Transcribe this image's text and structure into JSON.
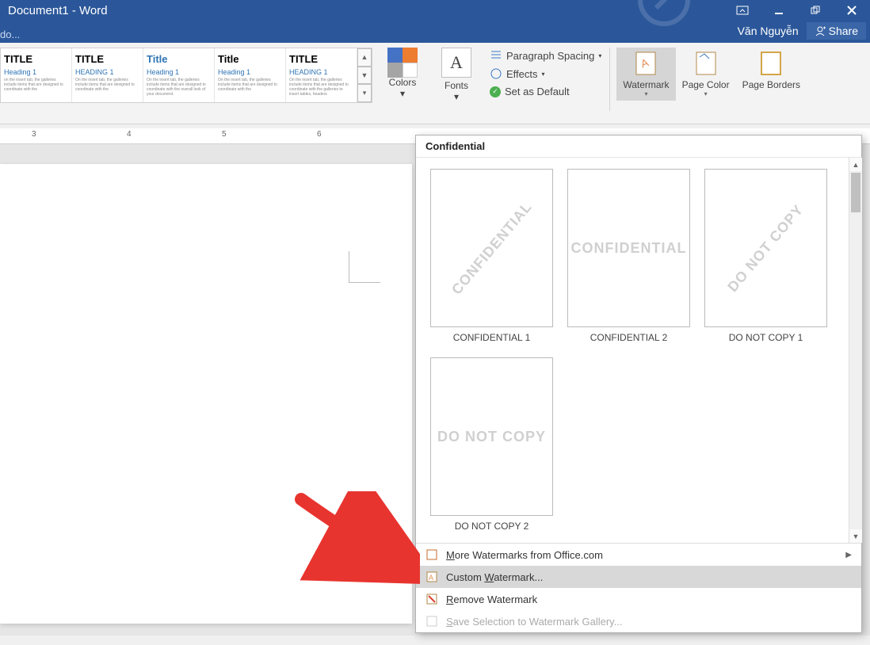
{
  "title": "Document1 - Word",
  "undo_hint": "do...",
  "user": "Văn Nguyễn",
  "share_label": "Share",
  "ribbon": {
    "colors": "Colors",
    "fonts": "Fonts",
    "para_spacing": "Paragraph Spacing",
    "effects": "Effects",
    "set_default": "Set as Default",
    "watermark": "Watermark",
    "page_color": "Page Color",
    "page_borders": "Page Borders"
  },
  "styles": [
    {
      "title": "TITLE",
      "heading": "Heading 1"
    },
    {
      "title": "TITLE",
      "heading": "HEADING 1"
    },
    {
      "title": "Title",
      "heading": "Heading 1"
    },
    {
      "title": "Title",
      "heading": "Heading 1"
    },
    {
      "title": "TITLE",
      "heading": "HEADING 1"
    }
  ],
  "ruler_nums": [
    "3",
    "4",
    "5",
    "6"
  ],
  "watermark_panel": {
    "category": "Confidential",
    "items": [
      {
        "text": "CONFIDENTIAL",
        "diagonal": true,
        "label": "CONFIDENTIAL 1"
      },
      {
        "text": "CONFIDENTIAL",
        "diagonal": false,
        "label": "CONFIDENTIAL 2"
      },
      {
        "text": "DO NOT COPY",
        "diagonal": true,
        "label": "DO NOT COPY 1"
      },
      {
        "text": "DO NOT COPY",
        "diagonal": false,
        "label": "DO NOT COPY 2"
      }
    ],
    "menu": {
      "more": "More Watermarks from Office.com",
      "custom": "Custom Watermark...",
      "remove": "Remove Watermark",
      "save": "Save Selection to Watermark Gallery..."
    }
  }
}
